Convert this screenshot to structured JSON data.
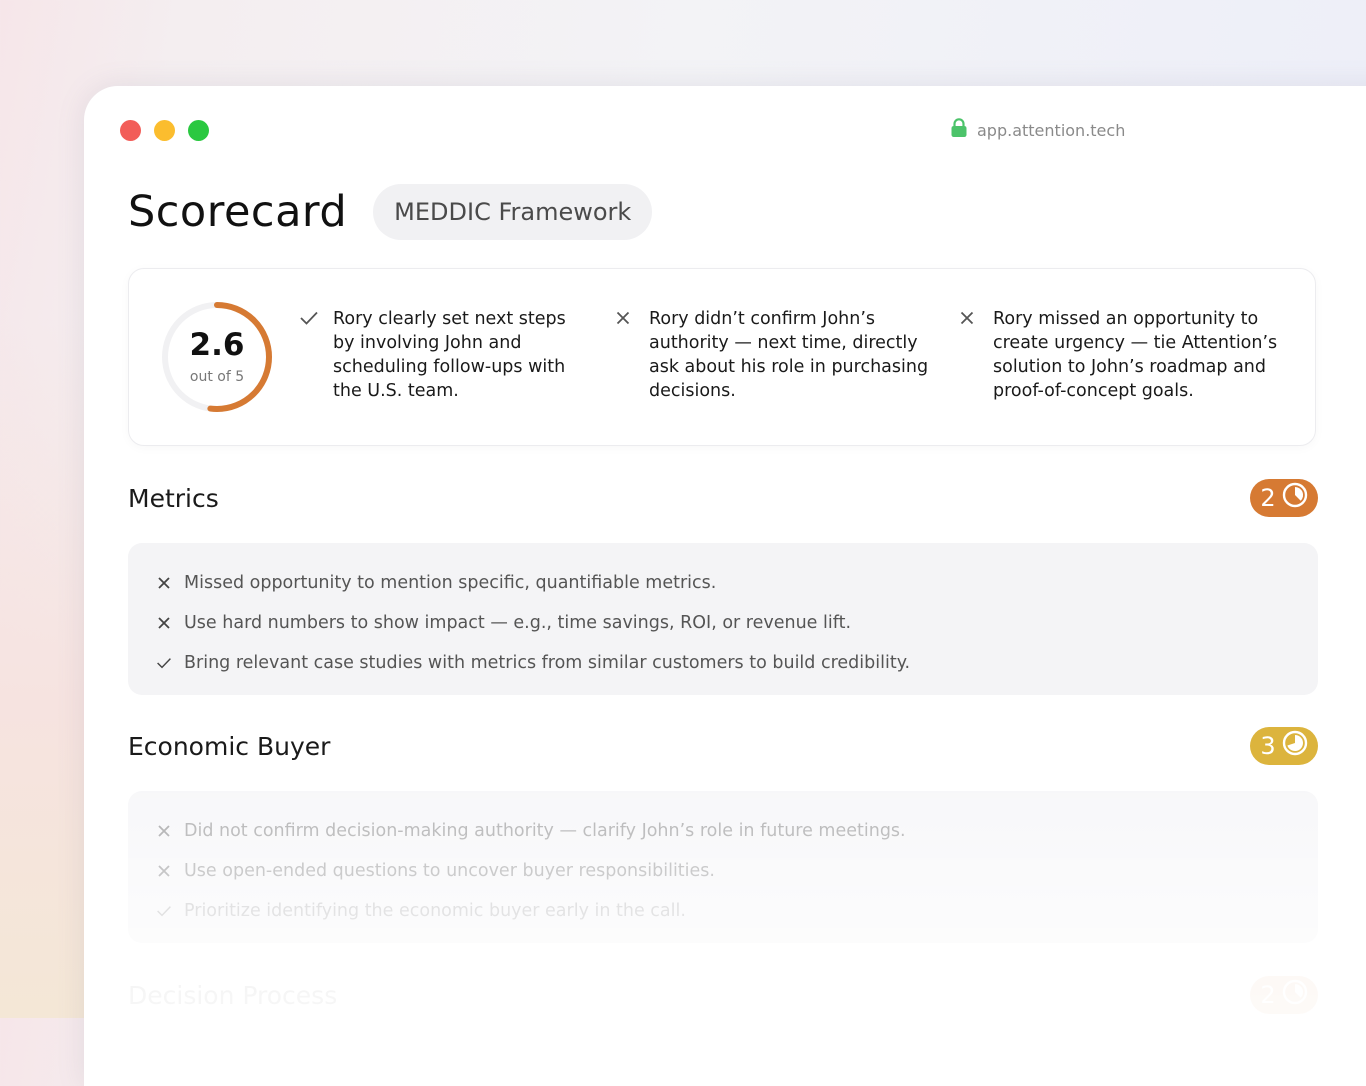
{
  "browser": {
    "url": "app.attention.tech"
  },
  "header": {
    "title": "Scorecard",
    "framework": "MEDDIC Framework"
  },
  "summary": {
    "score": "2.6",
    "score_caption": "out of 5",
    "score_value": 2.6,
    "score_max": 5,
    "accent": "#d67a33",
    "insights": [
      {
        "status": "check",
        "text": "Rory clearly set next steps by involving John and scheduling follow-ups with the U.S. team."
      },
      {
        "status": "cross",
        "text": "Rory didn’t confirm John’s authority — next time, directly ask about his role in purchasing decisions."
      },
      {
        "status": "cross",
        "text": "Rory missed an opportunity to create urgency — tie Attention’s solution to John’s roadmap and proof-of-concept goals."
      }
    ]
  },
  "sections": [
    {
      "title": "Metrics",
      "score": "2",
      "badge_color": "#d67a33",
      "items": [
        {
          "status": "cross",
          "text": "Missed opportunity to mention specific, quantifiable metrics."
        },
        {
          "status": "cross",
          "text": "Use hard numbers to show impact — e.g., time savings, ROI, or revenue lift."
        },
        {
          "status": "check",
          "text": "Bring relevant case studies with metrics from similar customers to build credibility."
        }
      ]
    },
    {
      "title": "Economic Buyer",
      "score": "3",
      "badge_color": "#dcb43d",
      "items": [
        {
          "status": "cross",
          "text": "Did not confirm decision-making authority — clarify John’s role in future meetings."
        },
        {
          "status": "cross",
          "text": "Use open-ended questions to uncover buyer responsibilities."
        },
        {
          "status": "check",
          "text": "Prioritize identifying the economic buyer early in the call."
        }
      ]
    },
    {
      "title": "Decision Process",
      "score": "2",
      "badge_color": "#d67a33"
    }
  ]
}
